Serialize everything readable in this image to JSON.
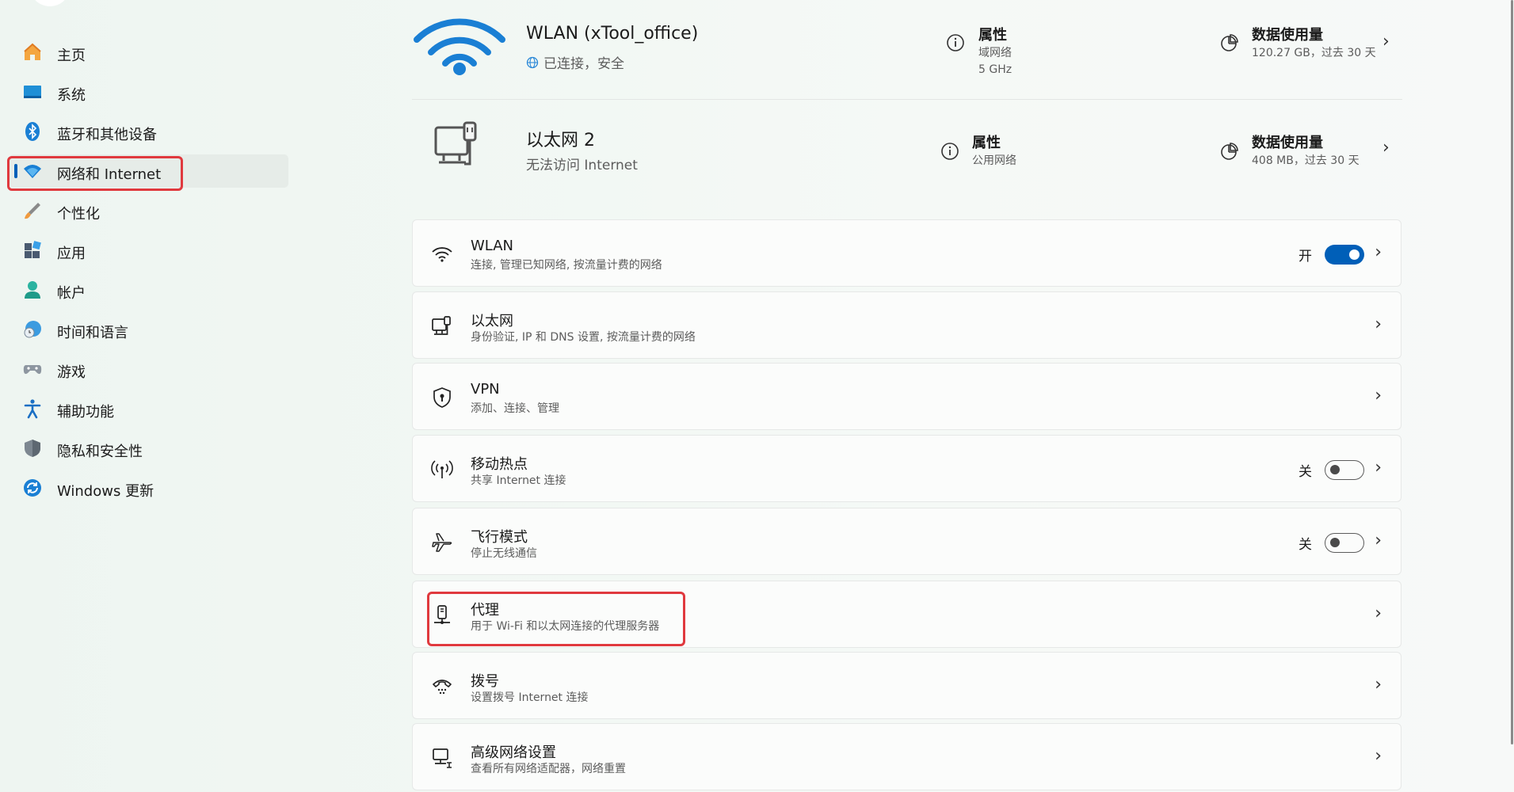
{
  "sidebar": {
    "items": [
      {
        "label": "主页",
        "icon": "home-icon"
      },
      {
        "label": "系统",
        "icon": "system-icon"
      },
      {
        "label": "蓝牙和其他设备",
        "icon": "bluetooth-icon"
      },
      {
        "label": "网络和 Internet",
        "icon": "wifi-icon",
        "active": true
      },
      {
        "label": "个性化",
        "icon": "brush-icon"
      },
      {
        "label": "应用",
        "icon": "apps-icon"
      },
      {
        "label": "帐户",
        "icon": "account-icon"
      },
      {
        "label": "时间和语言",
        "icon": "clock-globe-icon"
      },
      {
        "label": "游戏",
        "icon": "gamepad-icon"
      },
      {
        "label": "辅助功能",
        "icon": "accessibility-icon"
      },
      {
        "label": "隐私和安全性",
        "icon": "shield-icon"
      },
      {
        "label": "Windows 更新",
        "icon": "update-icon"
      }
    ]
  },
  "connections": [
    {
      "title": "WLAN (xTool_office)",
      "status": "已连接，安全",
      "properties_label": "属性",
      "properties_sub": [
        "域网络",
        "5 GHz"
      ],
      "usage_label": "数据使用量",
      "usage_sub": "120.27 GB，过去 30 天"
    },
    {
      "title": "以太网 2",
      "status": "无法访问 Internet",
      "properties_label": "属性",
      "properties_sub": [
        "公用网络"
      ],
      "usage_label": "数据使用量",
      "usage_sub": "408 MB，过去 30 天"
    }
  ],
  "settings": [
    {
      "title": "WLAN",
      "subtitle": "连接, 管理已知网络, 按流量计费的网络",
      "icon": "wifi-icon",
      "toggle_state": "开",
      "toggle_on": true
    },
    {
      "title": "以太网",
      "subtitle": "身份验证, IP 和 DNS 设置, 按流量计费的网络",
      "icon": "ethernet-icon"
    },
    {
      "title": "VPN",
      "subtitle": "添加、连接、管理",
      "icon": "vpn-shield-icon"
    },
    {
      "title": "移动热点",
      "subtitle": "共享 Internet 连接",
      "icon": "hotspot-icon",
      "toggle_state": "关",
      "toggle_on": false
    },
    {
      "title": "飞行模式",
      "subtitle": "停止无线通信",
      "icon": "airplane-icon",
      "toggle_state": "关",
      "toggle_on": false
    },
    {
      "title": "代理",
      "subtitle": "用于 Wi-Fi 和以太网连接的代理服务器",
      "icon": "proxy-icon"
    },
    {
      "title": "拨号",
      "subtitle": "设置拨号 Internet 连接",
      "icon": "dialup-icon"
    },
    {
      "title": "高级网络设置",
      "subtitle": "查看所有网络适配器，网络重置",
      "icon": "advanced-network-icon"
    }
  ],
  "colors": {
    "accent": "#005fb8",
    "highlight": "#e0393e"
  }
}
